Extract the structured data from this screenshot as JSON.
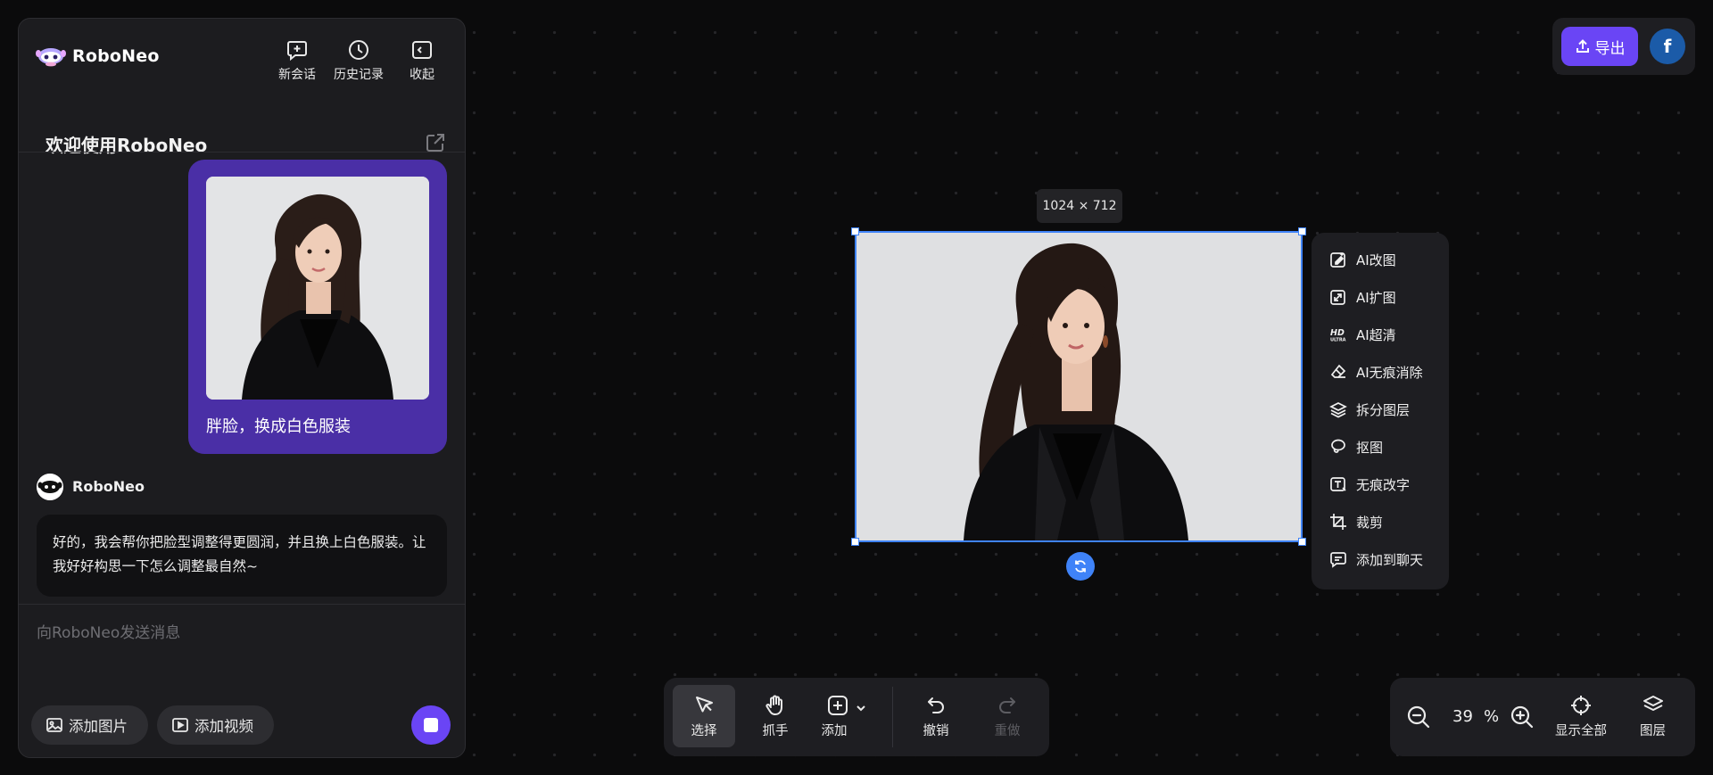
{
  "app": {
    "brand": "RoboNeo"
  },
  "header": {
    "new_chat": "新会话",
    "history": "历史记录",
    "collapse": "收起"
  },
  "chat": {
    "welcome_title": "欢迎使用RoboNeo",
    "user_message": "胖脸，换成白色服装",
    "bot_name": "RoboNeo",
    "bot_message": "好的，我会帮你把脸型调整得更圆润，并且换上白色服装。让我好好构思一下怎么调整最自然~",
    "input_placeholder": "向RoboNeo发送消息",
    "add_image": "添加图片",
    "add_video": "添加视频"
  },
  "topbar": {
    "export_label": "导出",
    "avatar_letter": "f"
  },
  "canvas": {
    "dimensions": "1024 × 712"
  },
  "context_menu": {
    "items": [
      "AI改图",
      "AI扩图",
      "AI超清",
      "AI无痕消除",
      "拆分图层",
      "抠图",
      "无痕改字",
      "裁剪",
      "添加到聊天"
    ]
  },
  "toolbar": {
    "select": "选择",
    "hand": "抓手",
    "add": "添加",
    "undo": "撤销",
    "redo": "重做"
  },
  "zoom": {
    "value": "39",
    "unit": "%",
    "fit_all": "显示全部",
    "layers": "图层"
  },
  "colors": {
    "accent": "#6a45f5",
    "selection": "#3f83f8",
    "user_bubble": "#4a2fa6"
  }
}
